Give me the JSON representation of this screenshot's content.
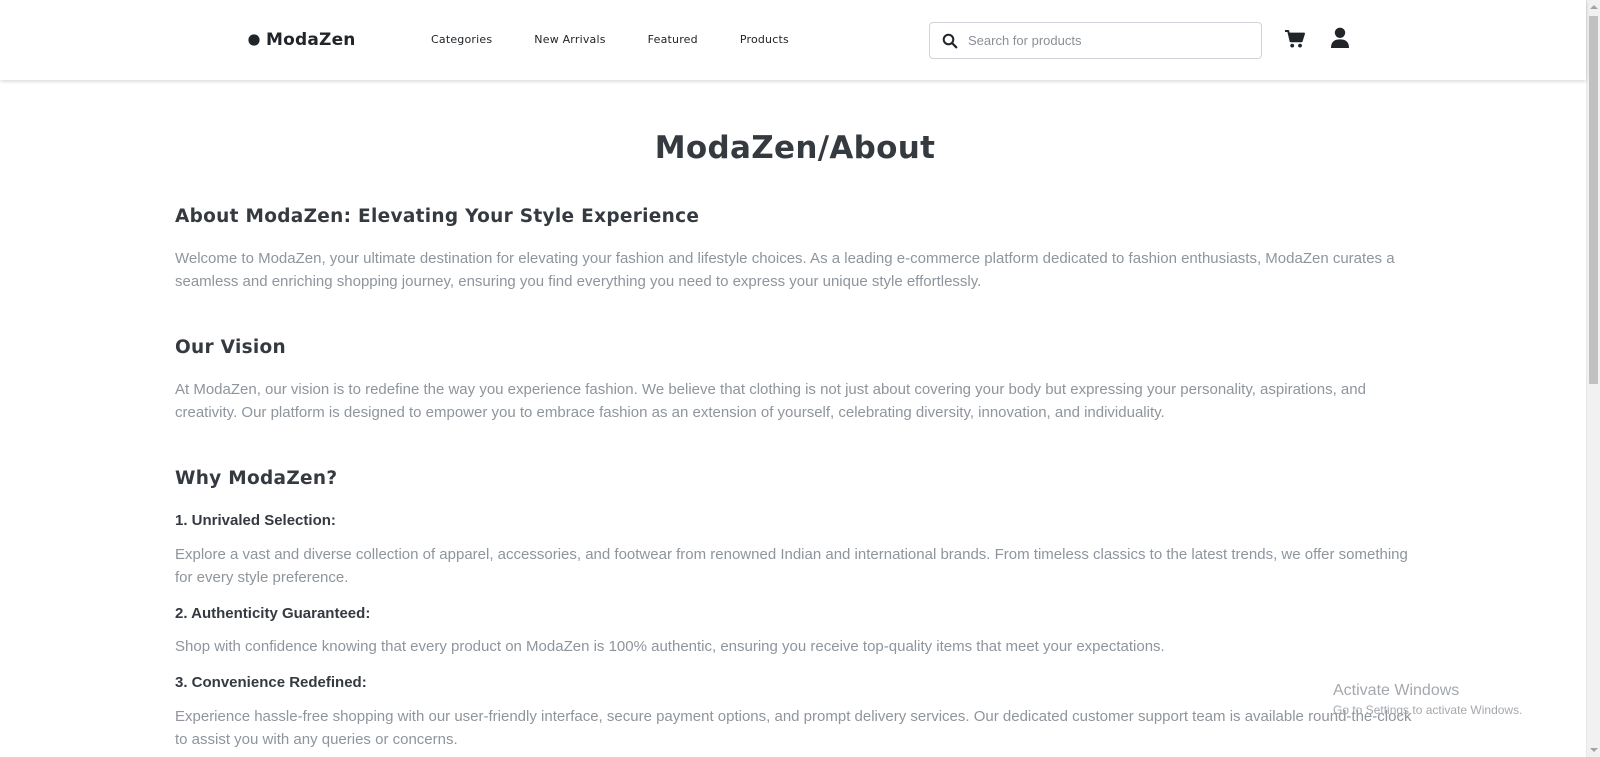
{
  "nav": {
    "brand": "ModaZen",
    "links": [
      "Categories",
      "New Arrivals",
      "Featured",
      "Products"
    ],
    "search_placeholder": "Search for products",
    "icons": [
      "search-icon",
      "cart-icon",
      "user-icon"
    ]
  },
  "main": {
    "title": "ModaZen/About",
    "about_heading": "About ModaZen: Elevating Your Style Experience",
    "about_text": "Welcome to ModaZen, your ultimate destination for elevating your fashion and lifestyle choices. As a leading e-commerce platform dedicated to fashion enthusiasts, ModaZen curates a seamless and enriching shopping journey, ensuring you find everything you need to express your unique style effortlessly.",
    "vision_heading": "Our Vision",
    "vision_text": "At ModaZen, our vision is to redefine the way you experience fashion. We believe that clothing is not just about covering your body but expressing your personality, aspirations, and creativity. Our platform is designed to empower you to embrace fashion as an extension of yourself, celebrating diversity, innovation, and individuality.",
    "why_heading": "Why ModaZen?",
    "points": [
      {
        "title": "1. Unrivaled Selection:",
        "text": "Explore a vast and diverse collection of apparel, accessories, and footwear from renowned Indian and international brands. From timeless classics to the latest trends, we offer something for every style preference."
      },
      {
        "title": "2. Authenticity Guaranteed:",
        "text": "Shop with confidence knowing that every product on ModaZen is 100% authentic, ensuring you receive top-quality items that meet your expectations."
      },
      {
        "title": "3. Convenience Redefined:",
        "text": "Experience hassle-free shopping with our user-friendly interface, secure payment options, and prompt delivery services. Our dedicated customer support team is available round-the-clock to assist you with any queries or concerns."
      }
    ]
  },
  "watermark": {
    "line1": "Activate Windows",
    "line2": "Go to Settings to activate Windows."
  },
  "colors": {
    "heading": "#343a40",
    "body_text": "#8e959c",
    "nav_text": "#212529"
  }
}
